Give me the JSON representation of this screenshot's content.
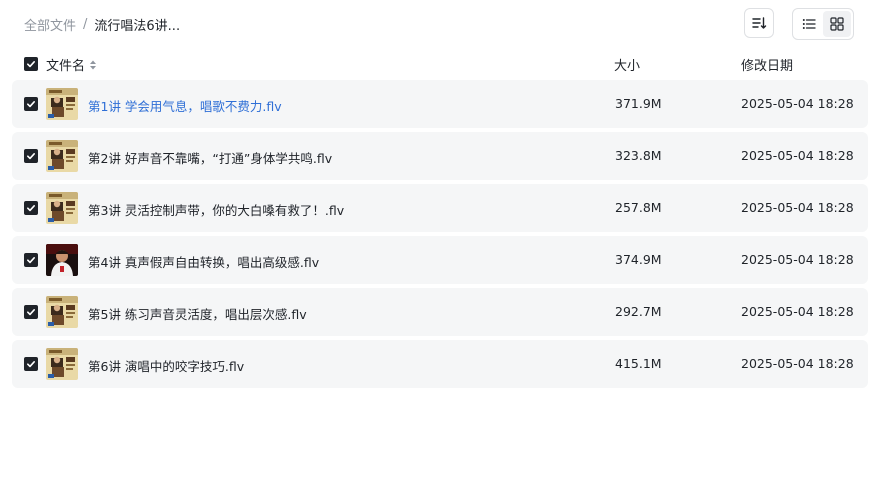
{
  "breadcrumb": {
    "root": "全部文件",
    "separator": "/",
    "current": "流行唱法6讲..."
  },
  "toolbar": {
    "sort_icon": "sort-icon",
    "list_view_icon": "list-view-icon",
    "grid_view_icon": "grid-view-icon",
    "active_view": "list"
  },
  "table": {
    "columns": {
      "name": "文件名",
      "size": "大小",
      "modified": "修改日期"
    },
    "rows": [
      {
        "name": "第1讲 学会用气息，唱歌不费力.flv",
        "size": "371.9M",
        "modified": "2025-05-04 18:28",
        "checked": true,
        "thumb": "poster"
      },
      {
        "name": "第2讲 好声音不靠嘴，“打通”身体学共鸣.flv",
        "size": "323.8M",
        "modified": "2025-05-04 18:28",
        "checked": true,
        "thumb": "poster"
      },
      {
        "name": "第3讲 灵活控制声带，你的大白嗓有救了！.flv",
        "size": "257.8M",
        "modified": "2025-05-04 18:28",
        "checked": true,
        "thumb": "poster"
      },
      {
        "name": "第4讲 真声假声自由转换，唱出高级感.flv",
        "size": "374.9M",
        "modified": "2025-05-04 18:28",
        "checked": true,
        "thumb": "portrait"
      },
      {
        "name": "第5讲 练习声音灵活度，唱出层次感.flv",
        "size": "292.7M",
        "modified": "2025-05-04 18:28",
        "checked": true,
        "thumb": "poster"
      },
      {
        "name": "第6讲 演唱中的咬字技巧.flv",
        "size": "415.1M",
        "modified": "2025-05-04 18:28",
        "checked": true,
        "thumb": "poster"
      }
    ]
  },
  "colors": {
    "link": "#2f6fd6",
    "row_bg": "#f5f6f7",
    "checkbox": "#1f2329"
  }
}
